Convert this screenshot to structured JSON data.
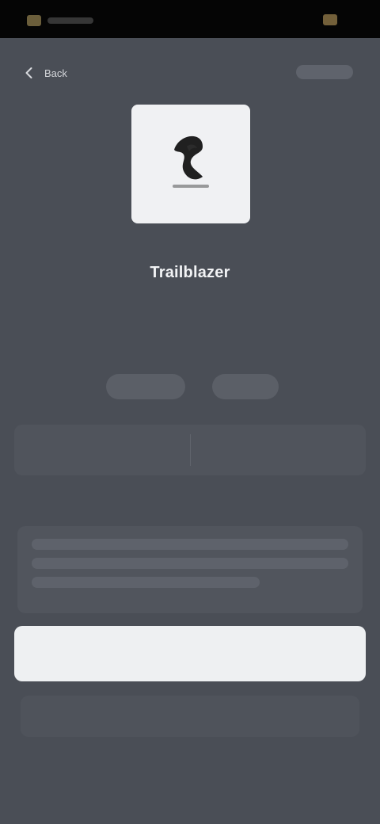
{
  "header": {
    "back_label": "Back"
  },
  "badge": {
    "subtitle": "",
    "title": "Trailblazer"
  },
  "description": "",
  "chips": [
    {
      "label": ""
    },
    {
      "label": ""
    }
  ],
  "stats": [
    {
      "value": "",
      "label": ""
    },
    {
      "value": "",
      "label": ""
    }
  ],
  "stats_note": "",
  "info": "",
  "actions": {
    "primary": "",
    "secondary": "",
    "footer": ""
  },
  "icons": {
    "back": "chevron-left-icon",
    "badge": "trail-mountain-icon"
  },
  "colors": {
    "background": "#4a4e56",
    "primary_button": "#eef0f2",
    "accent_pink": "#e3b4be"
  }
}
